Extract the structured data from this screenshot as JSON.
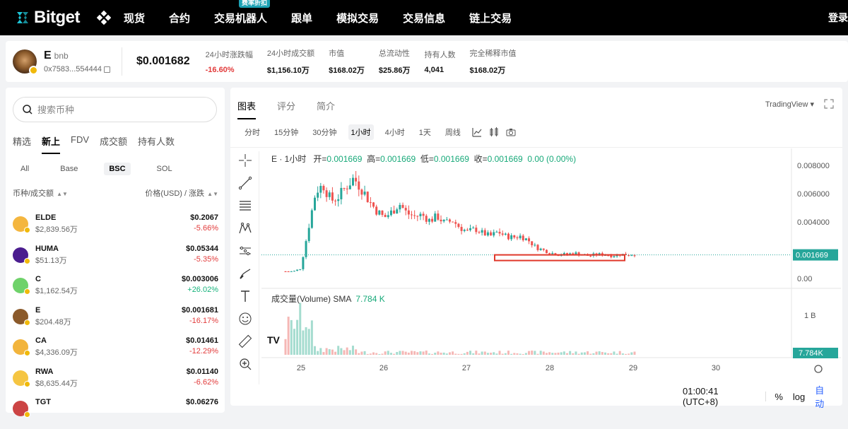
{
  "nav": {
    "logo": "Bitget",
    "items": [
      {
        "label": "现货",
        "badge": ""
      },
      {
        "label": "合约",
        "badge": ""
      },
      {
        "label": "交易机器人",
        "badge": "费率折扣"
      },
      {
        "label": "跟单",
        "badge": ""
      },
      {
        "label": "模拟交易",
        "badge": ""
      },
      {
        "label": "交易信息",
        "badge": ""
      },
      {
        "label": "链上交易",
        "badge": ""
      }
    ],
    "right_label": "登录"
  },
  "token": {
    "symbol": "E",
    "chain": "bnb",
    "address": "0x7583...554444",
    "price": "$0.001682",
    "stats": [
      {
        "label": "24小时涨跌幅",
        "value": "-16.60%",
        "tone": "neg"
      },
      {
        "label": "24小时成交额",
        "value": "$1,156.10万",
        "tone": ""
      },
      {
        "label": "市值",
        "value": "$168.02万",
        "tone": ""
      },
      {
        "label": "总流动性",
        "value": "$25.86万",
        "tone": ""
      },
      {
        "label": "持有人数",
        "value": "4,041",
        "tone": ""
      },
      {
        "label": "完全稀释市值",
        "value": "$168.02万",
        "tone": ""
      }
    ]
  },
  "left": {
    "search_placeholder": "搜索币种",
    "tabs": [
      "精选",
      "新上",
      "FDV",
      "成交额",
      "持有人数"
    ],
    "active_tab": 1,
    "chains": [
      "All",
      "Base",
      "BSC",
      "SOL"
    ],
    "active_chain": 2,
    "head_left": "币种/成交额",
    "head_right": "价格(USD) / 涨跌",
    "rows": [
      {
        "symbol": "ELDE",
        "volume": "$2,839.56万",
        "price": "$0.2067",
        "change": "-5.66%",
        "tone": "neg",
        "color": "#f4b63f"
      },
      {
        "symbol": "HUMA",
        "volume": "$51.13万",
        "price": "$0.05344",
        "change": "-5.35%",
        "tone": "neg",
        "color": "#4b1d8f"
      },
      {
        "symbol": "C",
        "volume": "$1,162.54万",
        "price": "$0.003006",
        "change": "+26.02%",
        "tone": "pos",
        "color": "#6fd26a"
      },
      {
        "symbol": "E",
        "volume": "$204.48万",
        "price": "$0.001681",
        "change": "-16.17%",
        "tone": "neg",
        "color": "#8b5a2b"
      },
      {
        "symbol": "CA",
        "volume": "$4,336.09万",
        "price": "$0.01461",
        "change": "-12.29%",
        "tone": "neg",
        "color": "#f2b43c"
      },
      {
        "symbol": "RWA",
        "volume": "$8,635.44万",
        "price": "$0.01140",
        "change": "-6.62%",
        "tone": "neg",
        "color": "#f5c542"
      },
      {
        "symbol": "TGT",
        "volume": "",
        "price": "$0.06276",
        "change": "",
        "tone": "",
        "color": "#c44"
      }
    ]
  },
  "chart": {
    "tabs": [
      "图表",
      "评分",
      "简介"
    ],
    "active_tab": 0,
    "provider": "TradingView",
    "intervals": [
      "分时",
      "15分钟",
      "30分钟",
      "1小时",
      "4小时",
      "1天",
      "周线"
    ],
    "active_interval": 3,
    "legend_prefix": "E  · 1小时",
    "legend_open_label": "开=",
    "legend_open": "0.001669",
    "legend_high_label": "高=",
    "legend_high": "0.001669",
    "legend_low_label": "低=",
    "legend_low": "0.001669",
    "legend_close_label": "收=",
    "legend_close": "0.001669",
    "legend_change": "0.00 (0.00%)",
    "volume_label": "成交量(Volume) SMA",
    "volume_value": "7.784 K",
    "clock": "01:00:41 (UTC+8)",
    "opt_percent": "%",
    "opt_log": "log",
    "opt_auto": "自动",
    "colors": {
      "up": "#26a69a",
      "down": "#ef5350",
      "accent": "#2962ff",
      "highlight": "#e0392b"
    }
  },
  "chart_data": {
    "type": "candlestick",
    "x_ticks": [
      "25",
      "26",
      "27",
      "28",
      "29",
      "30"
    ],
    "y_ticks": [
      "0.008000",
      "0.006000",
      "0.004000",
      "0.00"
    ],
    "ylim": [
      0,
      0.0085
    ],
    "current_price_label": "0.001669",
    "current_price": 0.001669,
    "volume_axis_label": "1 B",
    "volume_current_label": "7.784K",
    "close_path": [
      0.0005,
      0.0005,
      0.0007,
      0.0035,
      0.0062,
      0.0066,
      0.0055,
      0.0058,
      0.0065,
      0.0071,
      0.0064,
      0.0055,
      0.0048,
      0.0043,
      0.0047,
      0.0053,
      0.0046,
      0.0044,
      0.0045,
      0.0041,
      0.0044,
      0.0039,
      0.0041,
      0.0036,
      0.0033,
      0.0035,
      0.0032,
      0.003,
      0.0033,
      0.003,
      0.0029,
      0.003,
      0.0027,
      0.0022,
      0.002,
      0.0018,
      0.0017,
      0.0017,
      0.0018,
      0.0017,
      0.0016,
      0.0017,
      0.0017,
      0.0016,
      0.0017,
      0.0017,
      0.0017
    ]
  }
}
